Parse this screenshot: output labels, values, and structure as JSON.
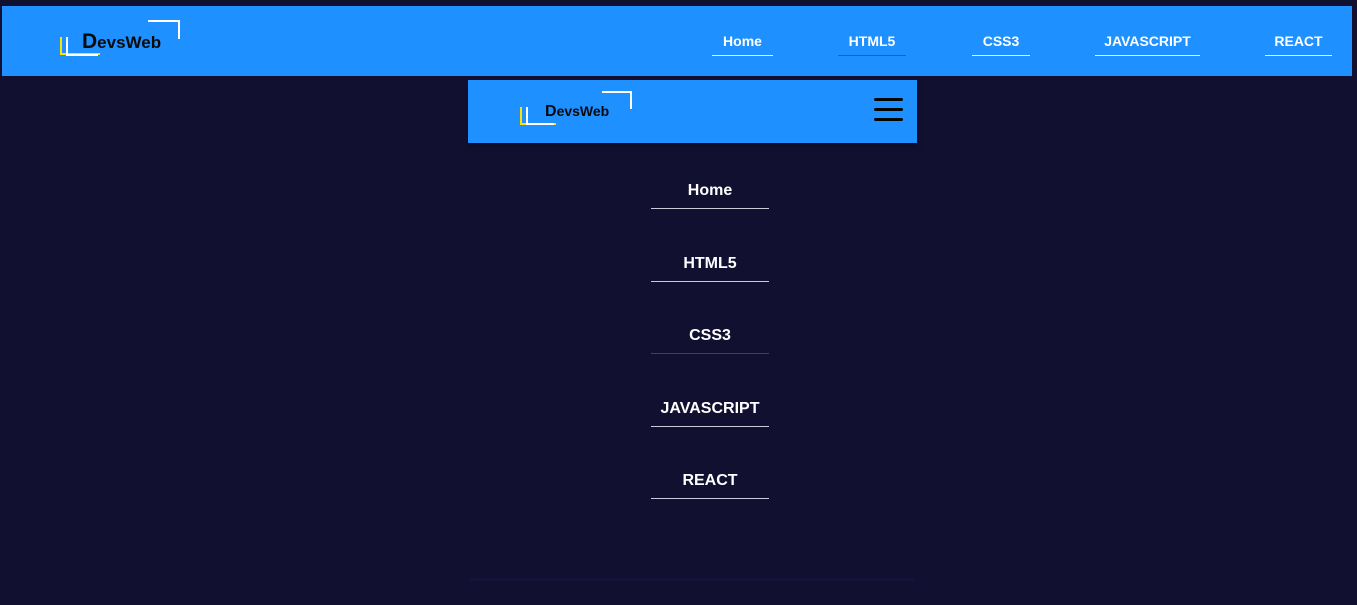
{
  "brand": {
    "initial": "D",
    "rest": "evsWeb"
  },
  "desktop_nav": {
    "items": [
      {
        "label": "Home"
      },
      {
        "label": "HTML5",
        "active": true
      },
      {
        "label": "CSS3"
      },
      {
        "label": "JAVASCRIPT"
      },
      {
        "label": "REACT"
      }
    ]
  },
  "mobile_nav": {
    "items": [
      {
        "label": "Home"
      },
      {
        "label": "HTML5"
      },
      {
        "label": "CSS3"
      },
      {
        "label": "JAVASCRIPT"
      },
      {
        "label": "REACT"
      }
    ]
  },
  "icons": {
    "menu": "hamburger-menu-icon"
  },
  "colors": {
    "header_bg": "#1e90ff",
    "page_bg": "#121030",
    "logo_accent": "#ffe100",
    "active_underline": "#7b2fd1",
    "text": "#ffffff"
  }
}
